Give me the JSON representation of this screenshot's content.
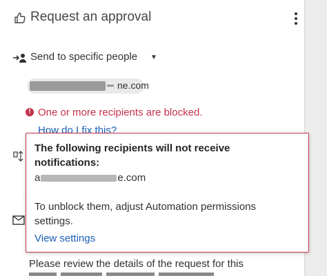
{
  "header": {
    "title": "Request an approval",
    "icon": "thumbs-up-icon",
    "menu_icon": "more-vertical-icon"
  },
  "send": {
    "label": "Send to specific people",
    "icon": "person-arrow-icon",
    "caret_icon": "caret-down-icon"
  },
  "recipient_pill": {
    "visible_tail": "ne.com"
  },
  "error": {
    "icon": "error-circle-icon",
    "message": "One or more recipients are blocked.",
    "help_link": "How do I fix this?",
    "color": "#c4314b"
  },
  "popup": {
    "title": "The following recipients will not receive notifications:",
    "recipient_start": "a",
    "recipient_tail": "e.com",
    "message": "To unblock them, adjust Automation permissions settings.",
    "link": "View settings",
    "border_color": "#c4314b"
  },
  "body": {
    "text": "Please review the details of the request for this"
  },
  "side_icons": [
    "details-icon",
    "mail-icon"
  ],
  "colors": {
    "link": "#1a5fb4",
    "text": "#323130"
  }
}
